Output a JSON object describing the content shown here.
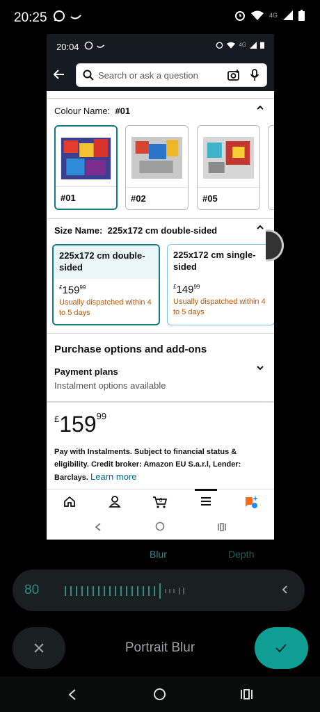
{
  "outer_status": {
    "time": "20:25",
    "network": "4G"
  },
  "inner_status": {
    "time": "20:04",
    "network": "4G"
  },
  "search": {
    "placeholder": "Search or ask a question"
  },
  "colour": {
    "label": "Colour Name:",
    "value": "#01",
    "swatches": [
      "#01",
      "#02",
      "#05"
    ]
  },
  "size": {
    "label": "Size Name:",
    "value": "225x172 cm double-sided",
    "options": [
      {
        "name": "225x172 cm double-sided",
        "currency": "£",
        "whole": "159",
        "fraction": "99",
        "dispatch": "Usually dispatched within 4 to 5 days"
      },
      {
        "name": "225x172 cm single-sided",
        "currency": "£",
        "whole": "149",
        "fraction": "99",
        "dispatch": "Usually dispatched within 4 to 5 days"
      }
    ]
  },
  "purchase": {
    "title": "Purchase options and add-ons",
    "payment_title": "Payment plans",
    "payment_sub": "Instalment options available"
  },
  "price": {
    "currency": "£",
    "whole": "159",
    "fraction": "99"
  },
  "instalment": {
    "text": "Pay with Instalments. Subject to financial status & eligibility. Credit broker: Amazon EU S.a.r.l, Lender: Barclays.",
    "link": "Learn more"
  },
  "editor": {
    "tab_blur": "Blur",
    "tab_depth": "Depth",
    "value": "80",
    "mode_label": "Portrait Blur"
  },
  "colors": {
    "teal": "#137a84",
    "accent": "#0f9e94",
    "orange": "#c45500"
  }
}
